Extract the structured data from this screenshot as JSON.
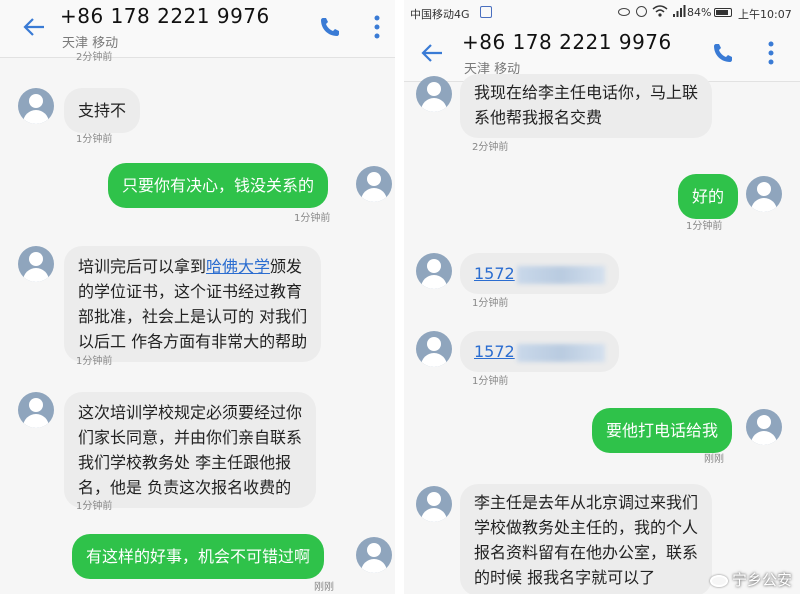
{
  "left": {
    "header": {
      "title": "+86 178 2221 9976",
      "subtitle": "天津 移动",
      "partial_time": "2分钟前"
    },
    "messages": [
      {
        "side": "in",
        "lines": [
          "支持不"
        ],
        "time": "1分钟前"
      },
      {
        "side": "out",
        "lines": [
          "只要你有决心，钱没关系的"
        ],
        "time": "1分钟前"
      },
      {
        "side": "in",
        "lines_pre": "培训完后可以拿到",
        "link": "哈佛大学",
        "lines_post": "颁发",
        "lines": [
          "的学位证书，这个证书经过教育",
          "部批准，社会上是认可的 对我们",
          "以后工 作各方面有非常大的帮助"
        ],
        "time": "1分钟前"
      },
      {
        "side": "in",
        "lines": [
          "这次培训学校规定必须要经过你",
          "们家长同意，并由你们亲自联系",
          "我们学校教务处 李主任跟他报",
          "名，他是 负责这次报名收费的"
        ],
        "time": "1分钟前"
      },
      {
        "side": "out",
        "lines": [
          "有这样的好事，机会不可错过啊"
        ],
        "time": "刚刚"
      }
    ]
  },
  "right": {
    "statusbar": {
      "carrier": "中国移动4G",
      "battery": "84%",
      "time": "上午10:07"
    },
    "header": {
      "title": "+86 178 2221 9976",
      "subtitle": "天津 移动"
    },
    "messages": [
      {
        "side": "in",
        "lines": [
          "我现在给李主任电话你，马上联",
          "系他帮我报名交费"
        ],
        "time": "2分钟前"
      },
      {
        "side": "out",
        "lines": [
          "好的"
        ],
        "time": "1分钟前"
      },
      {
        "side": "in",
        "number": "1572",
        "time": "1分钟前"
      },
      {
        "side": "in",
        "number": "1572",
        "time": "1分钟前"
      },
      {
        "side": "out",
        "lines": [
          "要他打电话给我"
        ],
        "time": "刚刚"
      },
      {
        "side": "in",
        "lines": [
          "李主任是去年从北京调过来我们",
          "学校做教务处主任的，我的个人",
          "报名资料留有在他办公室，联系",
          "的时候 报我名字就可以了"
        ],
        "time": ""
      }
    ]
  },
  "watermark": "宁乡公安",
  "colors": {
    "outgoing": "#2fc24a",
    "incoming": "#ececec",
    "accent": "#2b6dd0",
    "avatar": "#8fa5bd"
  },
  "icons": [
    "back-arrow-icon",
    "phone-icon",
    "more-vert-icon",
    "avatar-icon"
  ]
}
